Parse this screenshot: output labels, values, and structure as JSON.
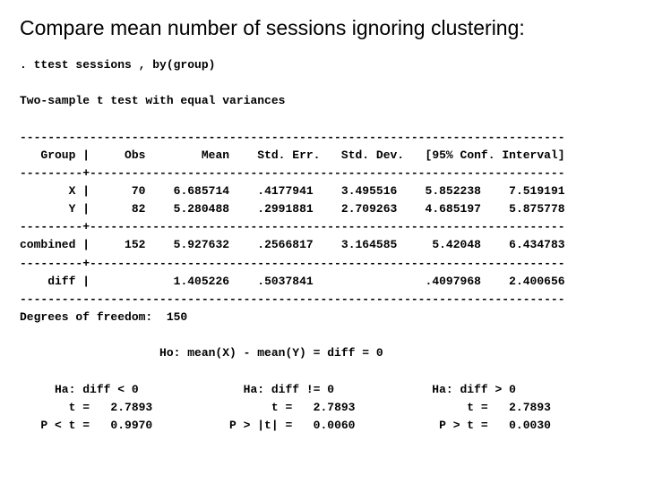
{
  "title": "Compare mean number of sessions ignoring clustering:",
  "cmd_line": ". ttest sessions , by(group)",
  "subtitle": "Two-sample t test with equal variances",
  "hdr": {
    "group": "   Group |",
    "obs": "     Obs",
    "mean": "        Mean",
    "se": "    Std. Err.",
    "sd": "   Std. Dev.",
    "ci": "   [95% Conf. Interval]"
  },
  "rowX": {
    "label": "       X |",
    "obs": "      70",
    "mean": "    6.685714",
    "se": "    .4177941",
    "sd": "    3.495516",
    "lo": "    5.852238",
    "hi": "    7.519191"
  },
  "rowY": {
    "label": "       Y |",
    "obs": "      82",
    "mean": "    5.280488",
    "se": "    .2991881",
    "sd": "    2.709263",
    "lo": "    4.685197",
    "hi": "    5.875778"
  },
  "rowC": {
    "label": "combined |",
    "obs": "     152",
    "mean": "    5.927632",
    "se": "    .2566817",
    "sd": "    3.164585",
    "lo": "     5.42048",
    "hi": "    6.434783"
  },
  "rowD": {
    "label": "    diff |",
    "obs": "        ",
    "mean": "    1.405226",
    "se": "    .5037841",
    "sd": "            ",
    "lo": "    .4097968",
    "hi": "    2.400656"
  },
  "dof": "Degrees of freedom:  150",
  "ho": "                    Ho: mean(X) - mean(Y) = diff = 0",
  "ha": {
    "l1": "     Ha: diff < 0",
    "l2": "       t =   2.7893",
    "l3": "   P < t =   0.9970",
    "c1": "               Ha: diff != 0",
    "c2": "                 t =   2.7893",
    "c3": "           P > |t| =   0.0060",
    "r1": "              Ha: diff > 0",
    "r2": "                t =   2.7893",
    "r3": "            P > t =   0.0030"
  },
  "rule78": "------------------------------------------------------------------------------",
  "rule9p": "---------+--------------------------------------------------------------------"
}
